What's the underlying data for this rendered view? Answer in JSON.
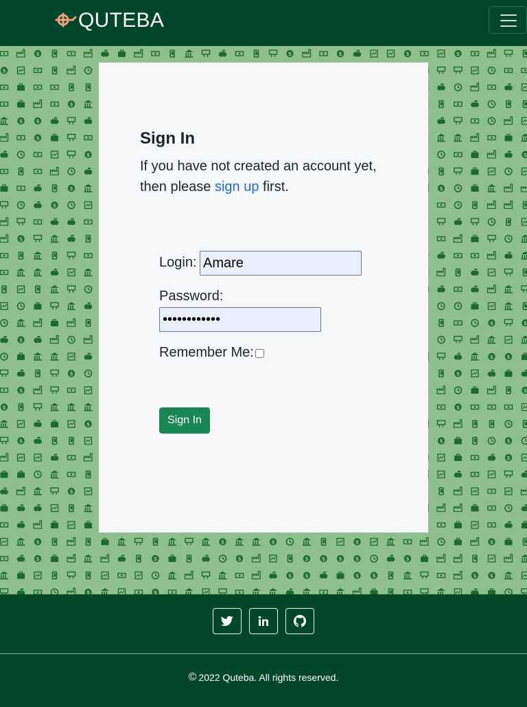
{
  "navbar": {
    "brand": "QUTEBA",
    "logo_icon": "quteba-logo-icon",
    "toggler_icon": "hamburger-menu-icon"
  },
  "background": {
    "pattern_icons": [
      "apple-icon",
      "dollar-coin-icon",
      "mobile-phone-icon",
      "clock-icon",
      "cash-icon",
      "factory-icon",
      "billboard-icon",
      "bank-icon",
      "briefcase-icon",
      "chart-icon"
    ]
  },
  "signin": {
    "title": "Sign In",
    "intro_before_link": "If you have not created an account yet, then please ",
    "link_text": "sign up",
    "intro_after_link": " first.",
    "login_label": "Login:",
    "login_value": "Amare",
    "password_label": "Password:",
    "password_value": "••••••••••••",
    "remember_label": "Remember Me:",
    "remember_checked": false,
    "submit_label": "Sign In"
  },
  "footer": {
    "social": [
      {
        "name": "twitter-icon"
      },
      {
        "name": "linkedin-icon"
      },
      {
        "name": "github-icon"
      }
    ],
    "copyright_symbol": "©",
    "copyright": "2022 Quteba. All rights reserved."
  },
  "colors": {
    "primary_dark": "#03472a",
    "pattern_background": "#8fbf8d",
    "pattern_icon": "#1d6b2b",
    "button_green": "#198754",
    "link_blue": "#2469d6",
    "logo_orange": "#f2a07b"
  }
}
